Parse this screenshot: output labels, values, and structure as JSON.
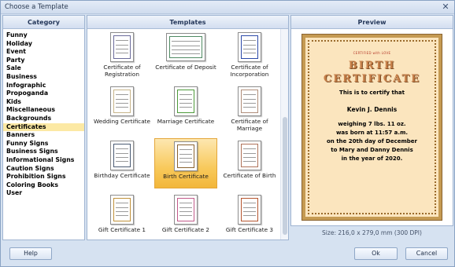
{
  "window": {
    "title": "Choose a Template",
    "close_glyph": "✕"
  },
  "category_panel": {
    "header": "Category",
    "items": [
      {
        "label": "Funny",
        "selected": false
      },
      {
        "label": "Holiday",
        "selected": false
      },
      {
        "label": "Event",
        "selected": false
      },
      {
        "label": "Party",
        "selected": false
      },
      {
        "label": "Sale",
        "selected": false
      },
      {
        "label": "Business",
        "selected": false
      },
      {
        "label": "Infographic",
        "selected": false
      },
      {
        "label": "Propoganda",
        "selected": false
      },
      {
        "label": "Kids",
        "selected": false
      },
      {
        "label": "Miscellaneous",
        "selected": false
      },
      {
        "label": "Backgrounds",
        "selected": false
      },
      {
        "label": "Certificates",
        "selected": true
      },
      {
        "label": "Banners",
        "selected": false
      },
      {
        "label": "Funny Signs",
        "selected": false
      },
      {
        "label": "Business Signs",
        "selected": false
      },
      {
        "label": "Informational Signs",
        "selected": false
      },
      {
        "label": "Caution Signs",
        "selected": false
      },
      {
        "label": "Prohibition Signs",
        "selected": false
      },
      {
        "label": "Coloring Books",
        "selected": false
      },
      {
        "label": "User",
        "selected": false
      }
    ]
  },
  "templates_panel": {
    "header": "Templates",
    "items": [
      {
        "label": "Certificate of Registration",
        "line1": "Certificate of",
        "line2": "Registration",
        "frame": "#6b6b9a",
        "orientation": "portrait",
        "selected": false
      },
      {
        "label": "Certificate of Deposit",
        "line1": "Certificate of Deposit",
        "line2": "",
        "frame": "#4f8a63",
        "orientation": "landscape",
        "selected": false
      },
      {
        "label": "Certificate of Incorporation",
        "line1": "Certificate of",
        "line2": "Incorporation",
        "frame": "#2c49a8",
        "orientation": "portrait",
        "selected": false
      },
      {
        "label": "Wedding Certificate",
        "line1": "Wedding Certificate",
        "line2": "",
        "frame": "#c7b48a",
        "orientation": "portrait",
        "selected": false
      },
      {
        "label": "Marriage Certificate",
        "line1": "Marriage Certificate",
        "line2": "",
        "frame": "#4d9a3a",
        "orientation": "portrait",
        "selected": false
      },
      {
        "label": "Certificate of Marriage",
        "line1": "Certificate of Marriage",
        "line2": "",
        "frame": "#b08e7a",
        "orientation": "portrait",
        "selected": false
      },
      {
        "label": "Birthday Certificate",
        "line1": "Birthday Certificate",
        "line2": "",
        "frame": "#4a5a72",
        "orientation": "portrait",
        "selected": false
      },
      {
        "label": "Birth Certificate",
        "line1": "Birth Certificate",
        "line2": "",
        "frame": "#8a6330",
        "orientation": "portrait",
        "selected": true
      },
      {
        "label": "Certificate of Birth",
        "line1": "Certificate of Birth",
        "line2": "",
        "frame": "#b0735a",
        "orientation": "portrait",
        "selected": false
      },
      {
        "label": "Gift Certificate 1",
        "line1": "Gift Certificate 1",
        "line2": "",
        "frame": "#c0913a",
        "orientation": "portrait",
        "selected": false
      },
      {
        "label": "Gift Certificate 2",
        "line1": "Gift Certificate 2",
        "line2": "",
        "frame": "#c25a8a",
        "orientation": "portrait",
        "selected": false
      },
      {
        "label": "Gift Certificate 3",
        "line1": "Gift Certificate 3",
        "line2": "",
        "frame": "#b5552f",
        "orientation": "portrait",
        "selected": false
      }
    ]
  },
  "preview_panel": {
    "header": "Preview",
    "certificate": {
      "small_caption": "CERTIFIED with LOVE",
      "title_line1": "BIRTH",
      "title_line2": "CERTIFICATE",
      "text_lines": [
        "This is to certify that",
        "Kevin J. Dennis",
        "weighing 7 lbs. 11 oz.",
        "was born at 11:57 a.m.",
        "on the 20th day of December",
        "to Mary and Danny Dennis",
        "in the year of 2020."
      ],
      "background": "#fbe5be",
      "border_color": "#c59a52"
    },
    "size_text": "Size: 216,0 x 279,0 mm (300 DPI)"
  },
  "buttons": {
    "help": "Help",
    "ok": "Ok",
    "cancel": "Cancel"
  },
  "colors": {
    "selected_category": "#fce9a4",
    "selected_tile": "#f8c95b",
    "window_bg": "#d6e2f1"
  }
}
